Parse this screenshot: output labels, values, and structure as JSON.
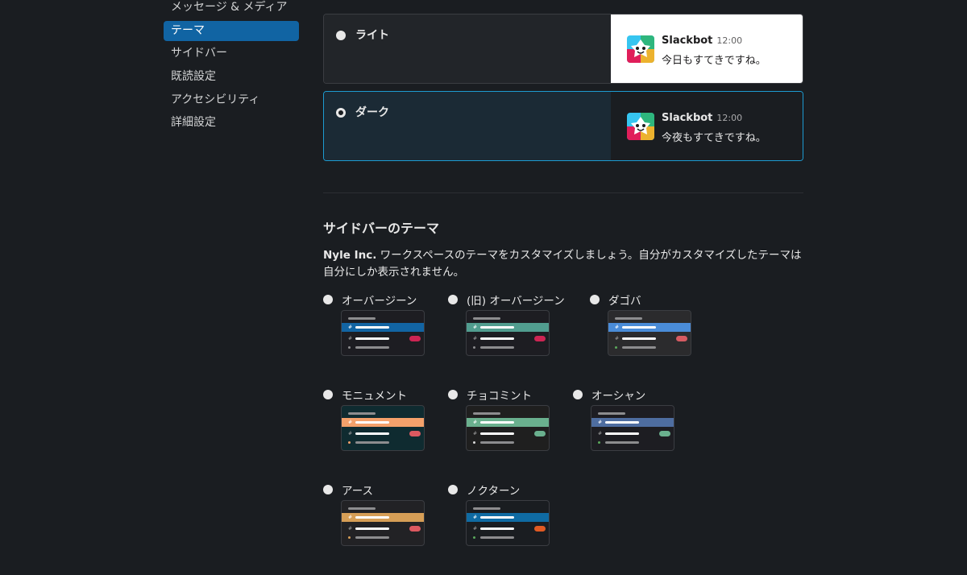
{
  "nav": {
    "items": [
      {
        "label": "メッセージ & メディア",
        "active": false
      },
      {
        "label": "テーマ",
        "active": true
      },
      {
        "label": "サイドバー",
        "active": false
      },
      {
        "label": "既読設定",
        "active": false
      },
      {
        "label": "アクセシビリティ",
        "active": false
      },
      {
        "label": "詳細設定",
        "active": false
      }
    ]
  },
  "appearance": {
    "light": {
      "label": "ライト",
      "selected": false,
      "bot_name": "Slackbot",
      "time": "12:00",
      "message": "今日もすてきですね。"
    },
    "dark": {
      "label": "ダーク",
      "selected": true,
      "bot_name": "Slackbot",
      "time": "12:00",
      "message": "今夜もすてきですね。"
    }
  },
  "sidebar_theme": {
    "title": "サイドバーのテーマ",
    "desc_workspace": "Nyle Inc.",
    "desc_text": " ワークスペースのテーマをカスタマイズしましょう。自分がカスタマイズしたテーマは自分にしか表示されません。",
    "themes": [
      {
        "name": "オーバージーン",
        "bg": "#1d1d22",
        "active": "#1264a3",
        "badge": "#cd2553",
        "dot": "#8d8d8f"
      },
      {
        "name": "(旧) オーバージーン",
        "bg": "#1d1d22",
        "active": "#519d8f",
        "badge": "#cd2553",
        "dot": "#8d8d8f"
      },
      {
        "name": "ダゴバ",
        "bg": "#2b2b2d",
        "active": "#4a8cd8",
        "badge": "#d65b62",
        "dot": "#5ba85b"
      },
      {
        "name": "モニュメント",
        "bg": "#0f2b30",
        "active": "#f4a16b",
        "badge": "#dc5960",
        "dot": "#f4a16b"
      },
      {
        "name": "チョコミント",
        "bg": "#1f1f1f",
        "active": "#6ab08e",
        "badge": "#6ab08e",
        "dot": "#d9d9d9"
      },
      {
        "name": "オーシャン",
        "bg": "#1d1d22",
        "active": "#4e6da0",
        "badge": "#6ab08e",
        "dot": "#5ba85b"
      },
      {
        "name": "アース",
        "bg": "#222225",
        "active": "#d69e56",
        "badge": "#dc5960",
        "dot": "#d69e56"
      },
      {
        "name": "ノクターン",
        "bg": "#1a1d21",
        "active": "#0f6ba3",
        "badge": "#e15a23",
        "dot": "#5ba85b"
      }
    ]
  }
}
